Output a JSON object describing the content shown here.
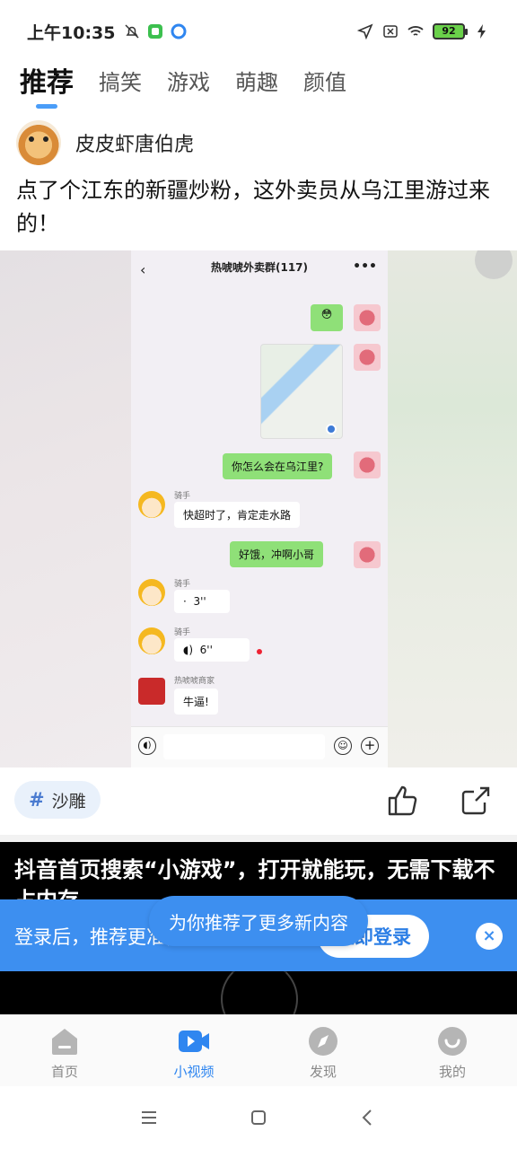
{
  "status_bar": {
    "time": "上午10:35",
    "battery": "92"
  },
  "tabs": [
    {
      "label": "推荐",
      "active": true
    },
    {
      "label": "搞笑"
    },
    {
      "label": "游戏"
    },
    {
      "label": "萌趣"
    },
    {
      "label": "颜值"
    }
  ],
  "post": {
    "author": "皮皮虾唐伯虎",
    "title": "点了个江东的新疆炒粉，这外卖员从乌江里游过来的！"
  },
  "chat": {
    "group_name": "热唬唬外卖群(117)",
    "messages": [
      {
        "from": "me",
        "text": "你怎么会在乌江里?"
      },
      {
        "sender": "骑手",
        "text": "快超时了，肯定走水路"
      },
      {
        "from": "me",
        "text": "好饿，冲啊小哥"
      },
      {
        "sender": "骑手",
        "text": "3''"
      },
      {
        "sender": "骑手",
        "text": "6''"
      },
      {
        "sender": "热唬唬商家",
        "text": "牛逼!"
      }
    ]
  },
  "tag": {
    "label": "沙雕"
  },
  "ad": {
    "title": "抖音首页搜索“小游戏”，打开就能玩，无需下载不占内存"
  },
  "login_banner": {
    "text": "登录后，推荐更准，内容更丰富",
    "button": "立即登录",
    "close": "×"
  },
  "toast": {
    "text": "为你推荐了更多新内容"
  },
  "bottom_nav": [
    {
      "label": "首页"
    },
    {
      "label": "小视频",
      "active": true
    },
    {
      "label": "发现"
    },
    {
      "label": "我的"
    }
  ],
  "colors": {
    "accent": "#2f86f0",
    "banner": "#3d8ff0",
    "chat_bubble_me": "#8fe078"
  }
}
